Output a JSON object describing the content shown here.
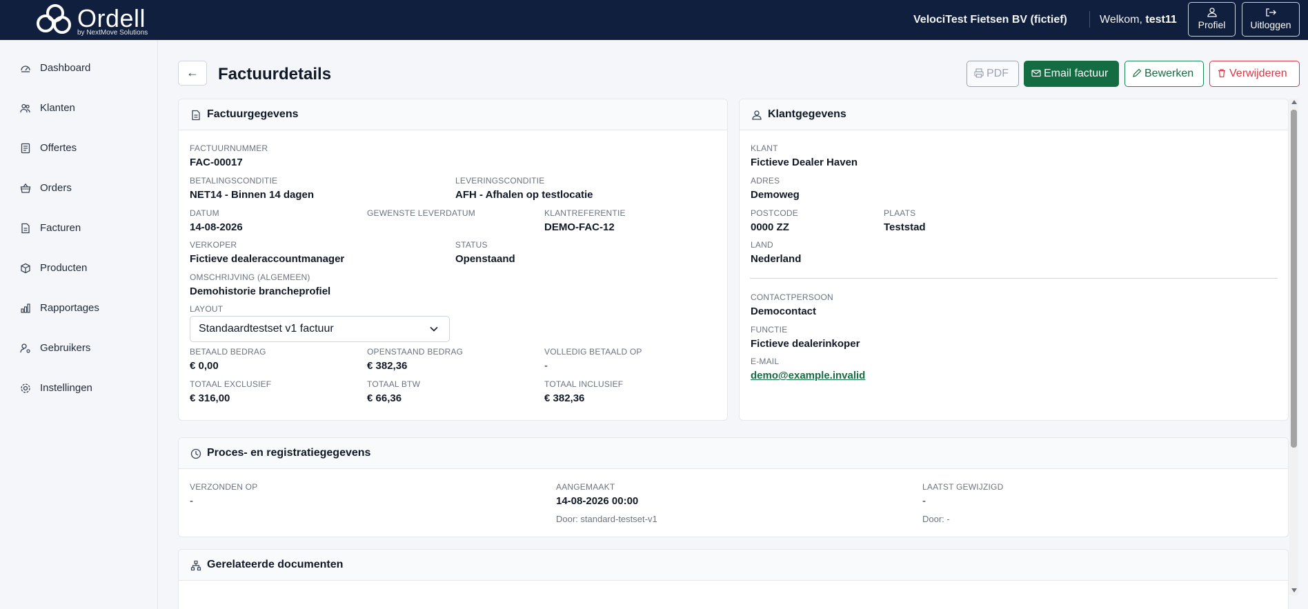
{
  "topbar": {
    "logo_text": "Ordell",
    "logo_sub": "by NextMove Solutions",
    "company": "VelociTest Fietsen BV (fictief)",
    "welcome_prefix": "Welkom,",
    "username": "test11",
    "profile_label": "Profiel",
    "logout_label": "Uitloggen"
  },
  "sidebar": {
    "items": [
      {
        "label": "Dashboard",
        "icon": "dashboard-icon"
      },
      {
        "label": "Klanten",
        "icon": "users-icon"
      },
      {
        "label": "Offertes",
        "icon": "quote-icon"
      },
      {
        "label": "Orders",
        "icon": "basket-icon"
      },
      {
        "label": "Facturen",
        "icon": "invoice-icon"
      },
      {
        "label": "Producten",
        "icon": "box-icon"
      },
      {
        "label": "Rapportages",
        "icon": "bar-chart-icon"
      },
      {
        "label": "Gebruikers",
        "icon": "user-gear-icon"
      },
      {
        "label": "Instellingen",
        "icon": "gear-icon"
      }
    ]
  },
  "header": {
    "back_symbol": "←",
    "title": "Factuurdetails",
    "pdf_label": "PDF",
    "email_label": "Email factuur",
    "edit_label": "Bewerken",
    "delete_label": "Verwijderen"
  },
  "invoice": {
    "title": "Factuurgegevens",
    "factuurnummer_label": "Factuurnummer",
    "factuurnummer": "FAC-00017",
    "betalingsconditie_label": "Betalingsconditie",
    "betalingsconditie": "NET14 - Binnen 14 dagen",
    "leveringsconditie_label": "Leveringsconditie",
    "leveringsconditie": "AFH - Afhalen op testlocatie",
    "datum_label": "Datum",
    "datum": "14-08-2026",
    "gewenste_leverdatum_label": "Gewenste leverdatum",
    "klantreferentie_label": "Klantreferentie",
    "klantreferentie": "DEMO-FAC-12",
    "verkoper_label": "Verkoper",
    "verkoper": "Fictieve dealeraccountmanager",
    "status_label": "Status",
    "status": "Openstaand",
    "omschrijving_label": "Omschrijving (algemeen)",
    "omschrijving": "Demohistorie brancheprofiel",
    "layout_label": "Layout",
    "layout_value": "Standaardtestset v1 factuur",
    "betaald_label": "Betaald bedrag",
    "betaald": "€ 0,00",
    "openstaand_label": "Openstaand bedrag",
    "openstaand": "€ 382,36",
    "volledig_label": "Volledig betaald op",
    "volledig": "-",
    "excl_label": "Totaal exclusief",
    "excl": "€ 316,00",
    "btw_label": "Totaal BTW",
    "btw": "€ 66,36",
    "incl_label": "Totaal inclusief",
    "incl": "€ 382,36"
  },
  "customer": {
    "title": "Klantgegevens",
    "klant_label": "Klant",
    "klant": "Fictieve Dealer Haven",
    "adres_label": "Adres",
    "adres": "Demoweg",
    "postcode_label": "Postcode",
    "postcode": "0000 ZZ",
    "plaats_label": "Plaats",
    "plaats": "Teststad",
    "land_label": "Land",
    "land": "Nederland",
    "contact_label": "Contactpersoon",
    "contact": "Democontact",
    "functie_label": "Functie",
    "functie": "Fictieve dealerinkoper",
    "email_label": "E-mail",
    "email": "demo@example.invalid"
  },
  "process": {
    "title": "Proces- en registratiegegevens",
    "verzonden_label": "Verzonden op",
    "verzonden": "-",
    "aangemaakt_label": "Aangemaakt",
    "aangemaakt": "14-08-2026 00:00",
    "aangemaakt_door": "Door: standard-testset-v1",
    "gewijzigd_label": "Laatst gewijzigd",
    "gewijzigd": "-",
    "gewijzigd_door": "Door: -"
  },
  "related": {
    "title": "Gerelateerde documenten"
  }
}
